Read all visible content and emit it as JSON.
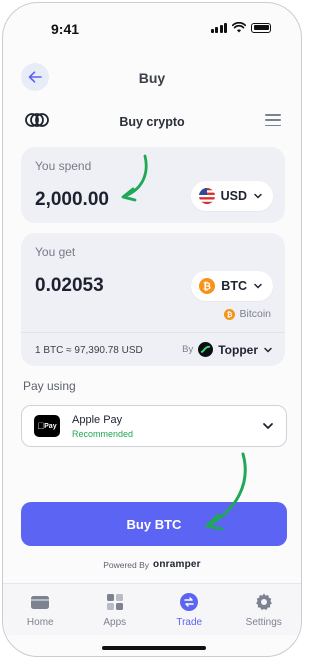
{
  "status_bar": {
    "time": "9:41"
  },
  "header": {
    "title": "Buy"
  },
  "widget": {
    "title": "Buy crypto"
  },
  "spend": {
    "label": "You spend",
    "amount": "2,000.00",
    "currency": "USD"
  },
  "get": {
    "label": "You get",
    "amount": "0.02053",
    "asset": "BTC",
    "asset_name": "Bitcoin",
    "rate": "1 BTC ≈ 97,390.78 USD",
    "by_label": "By",
    "provider": "Topper"
  },
  "pay": {
    "label": "Pay using",
    "method": "Apple Pay",
    "method_logo": "Pay",
    "recommended": "Recommended"
  },
  "buy_button": {
    "label": "Buy BTC"
  },
  "powered": {
    "prefix": "Powered By",
    "brand": "onramper"
  },
  "tabs": [
    {
      "label": "Home",
      "icon": "wallet-icon"
    },
    {
      "label": "Apps",
      "icon": "apps-grid-icon"
    },
    {
      "label": "Trade",
      "icon": "trade-icon"
    },
    {
      "label": "Settings",
      "icon": "gear-icon"
    }
  ],
  "colors": {
    "accent": "#5b64f3",
    "bitcoin": "#f7931a",
    "annotation_arrow": "#1fa855",
    "recommended": "#22a559"
  }
}
